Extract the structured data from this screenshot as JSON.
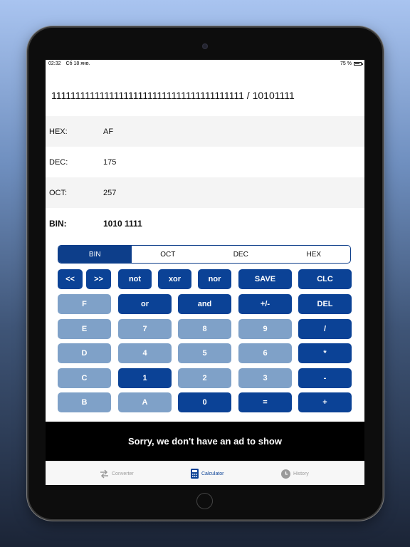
{
  "status": {
    "time": "02:32",
    "date": "Сб 18 янв.",
    "battery": "75 %"
  },
  "expression": "1111111111111111111111111111111111111111 / 10101111",
  "results": [
    {
      "label": "HEX:",
      "value": "AF"
    },
    {
      "label": "DEC:",
      "value": "175"
    },
    {
      "label": "OCT:",
      "value": "257"
    },
    {
      "label": "BIN:",
      "value": "1010 1111"
    }
  ],
  "modes": [
    "BIN",
    "OCT",
    "DEC",
    "HEX"
  ],
  "active_mode": "BIN",
  "keys": {
    "shift_left": "<<",
    "shift_right": ">>",
    "not": "not",
    "xor": "xor",
    "nor": "nor",
    "save": "SAVE",
    "clc": "CLC",
    "f": "F",
    "or": "or",
    "and": "and",
    "negate": "+/-",
    "del": "DEL",
    "e": "E",
    "seven": "7",
    "eight": "8",
    "nine": "9",
    "divide": "/",
    "d": "D",
    "four": "4",
    "five": "5",
    "six": "6",
    "multiply": "*",
    "c": "C",
    "one": "1",
    "two": "2",
    "three": "3",
    "minus": "-",
    "b": "B",
    "a": "A",
    "zero": "0",
    "equals": "=",
    "plus": "+"
  },
  "ad_text": "Sorry, we don't have an ad to show",
  "tabs": [
    {
      "label": "Converter",
      "icon": "arrows-swap-icon"
    },
    {
      "label": "Calculator",
      "icon": "calculator-icon"
    },
    {
      "label": "History",
      "icon": "clock-icon"
    }
  ],
  "colors": {
    "primary": "#0b4296",
    "secondary": "#7fa1c8"
  }
}
